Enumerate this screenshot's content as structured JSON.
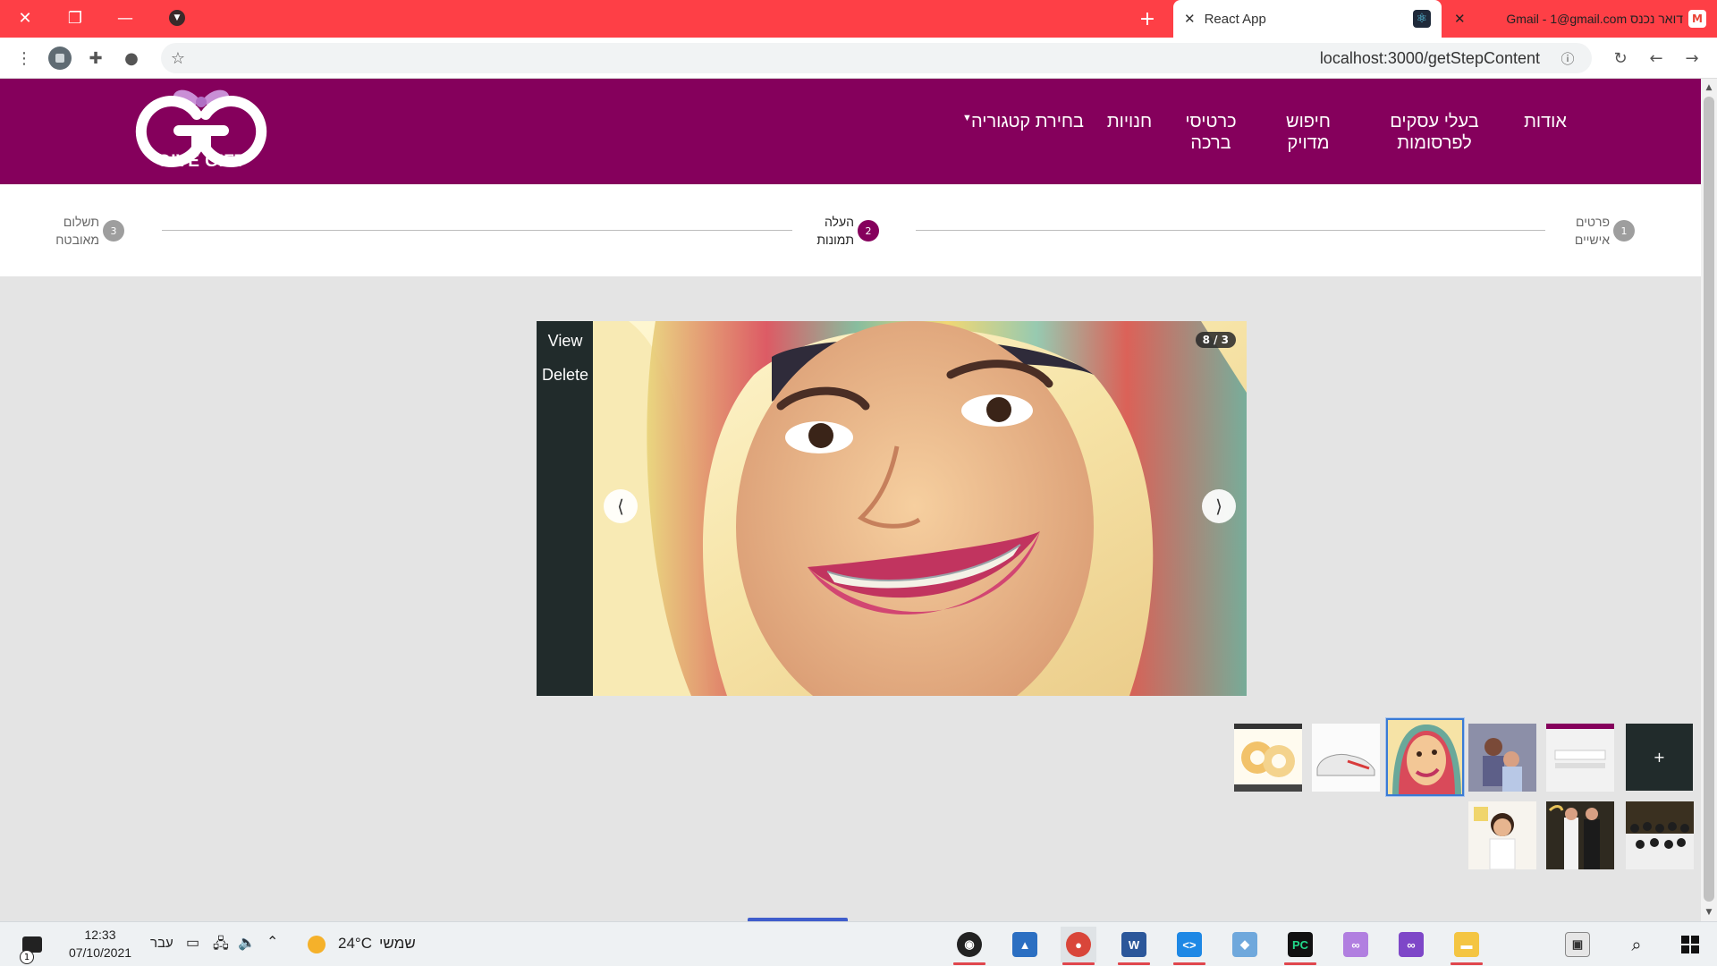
{
  "browser": {
    "tabs": [
      {
        "title": "React App",
        "active": true,
        "close": "✕"
      },
      {
        "title": "דואר נכנס Gmail - 1@gmail.com",
        "active": false,
        "close": "✕"
      }
    ],
    "new_tab": "+",
    "url": "localhost:3000/getStepContent",
    "window_controls": {
      "close": "✕",
      "restore": "❐",
      "minimize": "—"
    }
  },
  "app": {
    "logo_text": "GIVE GIFT",
    "nav": [
      {
        "label": "אודות"
      },
      {
        "label": "בעלי עסקים\nלפרסומות"
      },
      {
        "label": "חיפוש\nמדויק"
      },
      {
        "label": "כרטיסי\nברכה"
      },
      {
        "label": "חנויות"
      },
      {
        "label": "בחירת קטגוריה"
      }
    ],
    "colors": {
      "brand": "#85005c",
      "active_step": "#85005c",
      "inactive_step": "#9e9e9e"
    }
  },
  "stepper": {
    "steps": [
      {
        "number": "1",
        "line1": "פרטים",
        "line2": "אישיים",
        "active": false
      },
      {
        "number": "2",
        "line1": "העלה",
        "line2": "תמונות",
        "active": true
      },
      {
        "number": "3",
        "line1": "תשלום",
        "line2": "מאובטח",
        "active": false
      }
    ]
  },
  "gallery": {
    "actions": {
      "view": "View",
      "delete": "Delete"
    },
    "counter": "8 / 3",
    "prev": "⟨",
    "next": "⟩",
    "add_label": "+",
    "thumbnails": [
      {
        "kind": "document",
        "selected": false
      },
      {
        "kind": "photo-family",
        "selected": false
      },
      {
        "kind": "photo-portrait",
        "selected": true
      },
      {
        "kind": "photo-shoe",
        "selected": false
      },
      {
        "kind": "photo-cake",
        "selected": false
      },
      {
        "kind": "photo-group",
        "selected": false
      },
      {
        "kind": "photo-couple",
        "selected": false
      },
      {
        "kind": "photo-girl",
        "selected": false
      }
    ]
  },
  "taskbar": {
    "time": "12:33",
    "date": "07/10/2021",
    "language": "עבר",
    "weather": "24°C",
    "weather_label": "שמשי",
    "notification_count": "1"
  }
}
